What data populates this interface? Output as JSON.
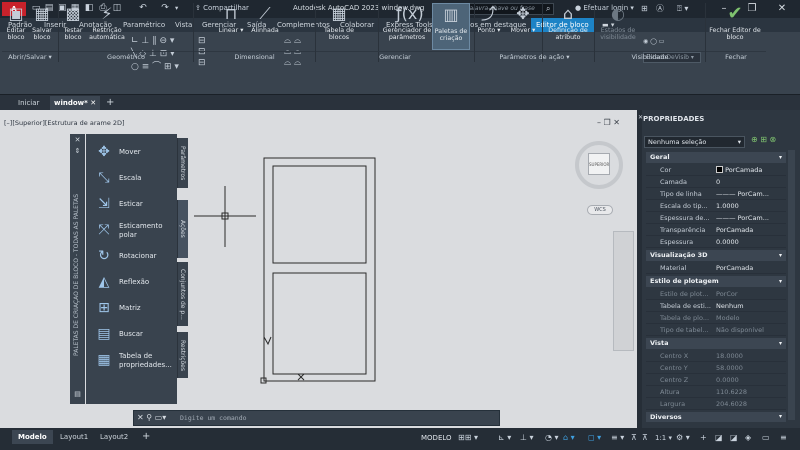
{
  "titlebar": {
    "logo": "A CAD",
    "qat_menu": "Padrão",
    "share": "Compartilhar",
    "app_title": "Autodesk AutoCAD 2023   window.dwg",
    "search_placeholder": "Digite palavra-chave ou frase",
    "login": "Efetuar login"
  },
  "ribbon_tabs": [
    "Padrão",
    "Inserir",
    "Anotação",
    "Paramétrico",
    "Vista",
    "Gerenciar",
    "Saída",
    "Complementos",
    "Colaborar",
    "Express Tools",
    "Aplicativos em destaque",
    "Editor de bloco"
  ],
  "ribbon_active_tab": "Editor de bloco",
  "ribbon": {
    "editar_bloco": "Editar bloco",
    "salvar_bloco": "Salvar bloco",
    "testar_bloco": "Testar bloco",
    "restricao_automatica": "Restrição automática",
    "linear": "Linear",
    "alinhada": "Alinhada",
    "tabela_de_blocos": "Tabela de blocos",
    "gerenciador_de_parametros": "Gerenciador de parâmetros",
    "paletas_de_criacao": "Paletas de criação",
    "ponto": "Ponto",
    "mover": "Mover",
    "definicao_de_atributo": "Definição de atributo",
    "estados_de_visibilidade": "Estados de visibilidade",
    "estado_vis": "EstadoDeVisib",
    "fechar_editor": "Fechar Editor de bloco"
  },
  "panels": {
    "abrir_salvar": "Abrir/Salvar ▾",
    "geometrico": "Geométrico",
    "dimensional": "Dimensional",
    "gerenciar": "Gerenciar",
    "parametros_acao": "Parâmetros de ação ▾",
    "visibilidade": "Visibilidade",
    "fechar": "Fechar"
  },
  "doc_tabs": {
    "home": "Iniciar",
    "active": "window*"
  },
  "viewport": {
    "label": "[–][Superior][Estrutura de arame 2D]",
    "viewcube_face": "SUPERIOR",
    "wcs": "WCS"
  },
  "palette": {
    "title": "PALETAS DE CRIAÇÃO DE BLOCO - TODAS AS PALETAS",
    "items": [
      "Mover",
      "Escala",
      "Esticar",
      "Esticamento polar",
      "Rotacionar",
      "Reflexão",
      "Matriz",
      "Buscar",
      "Tabela de propriedades..."
    ],
    "side_tabs": [
      "Parâmetros",
      "Ações",
      "Conjuntos de p...",
      "Restrições"
    ]
  },
  "command": {
    "placeholder": "Digite um comando"
  },
  "status": {
    "tab_model": "Modelo",
    "tab_layout1": "Layout1",
    "tab_layout2": "Layout2",
    "model_btn": "MODELO",
    "scale": "1:1"
  },
  "properties": {
    "title": "PROPRIEDADES",
    "selection": "Nenhuma seleção",
    "sections": {
      "geral": "Geral",
      "vis3d": "Visualização 3D",
      "plot": "Estilo de plotagem",
      "vista": "Vista",
      "diversos": "Diversos"
    },
    "geral": [
      {
        "k": "Cor",
        "v": "PorCamada"
      },
      {
        "k": "Camada",
        "v": "0"
      },
      {
        "k": "Tipo de linha",
        "v": "——— PorCam..."
      },
      {
        "k": "Escala do tip...",
        "v": "1.0000"
      },
      {
        "k": "Espessura  de...",
        "v": "——— PorCam..."
      },
      {
        "k": "Transparência",
        "v": "PorCamada"
      },
      {
        "k": "Espessura",
        "v": "0.0000"
      }
    ],
    "vis3d": [
      {
        "k": "Material",
        "v": "PorCamada"
      }
    ],
    "plot": [
      {
        "k": "Estilo de plot...",
        "v": "PorCor"
      },
      {
        "k": "Tabela de esti...",
        "v": "Nenhum"
      },
      {
        "k": "Tabela de plo...",
        "v": "Modelo"
      },
      {
        "k": "Tipo de tabel...",
        "v": "Não disponível"
      }
    ],
    "vista": [
      {
        "k": "Centro X",
        "v": "18.0000"
      },
      {
        "k": "Centro Y",
        "v": "58.0000"
      },
      {
        "k": "Centro Z",
        "v": "0.0000"
      },
      {
        "k": "Altura",
        "v": "110.6228"
      },
      {
        "k": "Largura",
        "v": "204.6028"
      }
    ]
  },
  "colors": {
    "accent": "#1d83c6",
    "logo": "#c8222b",
    "close": "#7fc26f"
  }
}
